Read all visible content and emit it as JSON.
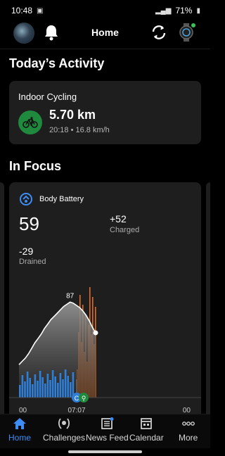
{
  "status_bar": {
    "time": "10:48",
    "battery": "71%"
  },
  "header": {
    "title": "Home"
  },
  "today": {
    "section_title": "Today’s Activity",
    "activity_name": "Indoor Cycling",
    "distance": "5.70 km",
    "meta": "20:18 • 16.8 km/h"
  },
  "focus": {
    "section_title": "In Focus",
    "card_title": "Body Battery",
    "current_value": "59",
    "charged_value": "+52",
    "charged_label": "Charged",
    "drained_value": "-29",
    "drained_label": "Drained"
  },
  "chart_data": {
    "type": "area",
    "title": "",
    "x_tick_labels": [
      "00",
      "07:07",
      "00"
    ],
    "peak_label": "87",
    "line_color": "#ffffff",
    "sleep_bar_color": "#2f7fd8",
    "stress_bar_color": "#e06a1e",
    "ylim": [
      0,
      100
    ],
    "series": [
      {
        "values": [
          30,
          33,
          36,
          40,
          45,
          50,
          54,
          58,
          63,
          67,
          71,
          74,
          77,
          80,
          83,
          85,
          87,
          86,
          84,
          82,
          79,
          75,
          70,
          64,
          59
        ]
      }
    ]
  },
  "nav": {
    "items": [
      {
        "label": "Home"
      },
      {
        "label": "Challenges"
      },
      {
        "label": "News Feed"
      },
      {
        "label": "Calendar"
      },
      {
        "label": "More"
      }
    ]
  },
  "colors": {
    "accent": "#3d8df5",
    "card": "#1e1e1e",
    "activity_green": "#1f8a3e"
  }
}
